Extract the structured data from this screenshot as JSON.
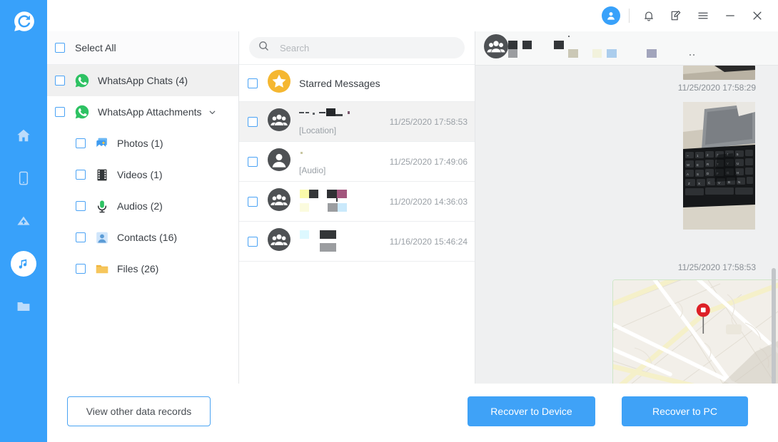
{
  "app": {
    "logo_icon": "whatsapp-recovery-logo",
    "accent_color": "#38a1fa",
    "bg_color": "#ffffff"
  },
  "rail": {
    "items": [
      {
        "icon": "home-icon",
        "name": "home",
        "active": false
      },
      {
        "icon": "device-icon",
        "name": "device",
        "active": false
      },
      {
        "icon": "cloud-upload-icon",
        "name": "cloud",
        "active": false
      },
      {
        "icon": "music-note-icon",
        "name": "media",
        "active": true
      },
      {
        "icon": "folder-icon",
        "name": "files",
        "active": false
      }
    ]
  },
  "titlebar": {
    "avatar_icon": "user-avatar-icon",
    "buttons": [
      {
        "icon": "bell-icon",
        "name": "notifications"
      },
      {
        "icon": "feedback-edit-icon",
        "name": "feedback"
      },
      {
        "icon": "hamburger-menu-icon",
        "name": "menu"
      },
      {
        "icon": "minimize-icon",
        "name": "minimize"
      },
      {
        "icon": "close-icon",
        "name": "close"
      }
    ]
  },
  "tree": {
    "select_all_label": "Select All",
    "items": [
      {
        "label": "WhatsApp Chats (4)",
        "icon": "whatsapp-icon",
        "level": 0,
        "selected": true,
        "chevron": false
      },
      {
        "label": "WhatsApp Attachments",
        "icon": "whatsapp-icon",
        "level": 0,
        "selected": false,
        "chevron": true
      },
      {
        "label": "Photos (1)",
        "icon": "photos-icon",
        "level": 1,
        "selected": false,
        "chevron": false
      },
      {
        "label": "Videos (1)",
        "icon": "videos-icon",
        "level": 1,
        "selected": false,
        "chevron": false
      },
      {
        "label": "Audios (2)",
        "icon": "microphone-icon",
        "level": 1,
        "selected": false,
        "chevron": false
      },
      {
        "label": "Contacts (16)",
        "icon": "contact-icon",
        "level": 1,
        "selected": false,
        "chevron": false
      },
      {
        "label": "Files (26)",
        "icon": "folder-yellow-icon",
        "level": 1,
        "selected": false,
        "chevron": false
      }
    ]
  },
  "search": {
    "placeholder": "Search",
    "value": "",
    "icon": "search-icon"
  },
  "message_list": {
    "starred": {
      "label": "Starred Messages",
      "icon": "star-icon"
    },
    "rows": [
      {
        "avatar": "group-avatar-icon",
        "title": "",
        "title_redacted": true,
        "subtitle": "[Location]",
        "time": "11/25/2020 17:58:53",
        "selected": true
      },
      {
        "avatar": "person-avatar-icon",
        "title": "",
        "title_redacted": true,
        "subtitle": "[Audio]",
        "time": "11/25/2020 17:49:06",
        "selected": false
      },
      {
        "avatar": "group-avatar-icon",
        "title": "",
        "title_redacted": true,
        "subtitle": "",
        "time": "11/20/2020 14:36:03",
        "selected": false
      },
      {
        "avatar": "group-avatar-icon",
        "title": "",
        "title_redacted": true,
        "subtitle": "",
        "time": "11/16/2020 15:46:24",
        "selected": false
      }
    ]
  },
  "conversation": {
    "header": {
      "avatar": "group-avatar-icon",
      "title": "",
      "title_redacted": true
    },
    "bubbles": [
      {
        "type": "photo",
        "name": "photo-attachment-partial",
        "time": "11/25/2020 17:58:29"
      },
      {
        "type": "photo",
        "name": "keyboard-photo-attachment",
        "time": "11/25/2020 17:58:53"
      },
      {
        "type": "map",
        "name": "location-map-attachment",
        "time": ""
      }
    ],
    "scroll_position": "bottom"
  },
  "footer": {
    "view_other_label": "View other data records",
    "recover_device_label": "Recover to Device",
    "recover_pc_label": "Recover to PC"
  }
}
